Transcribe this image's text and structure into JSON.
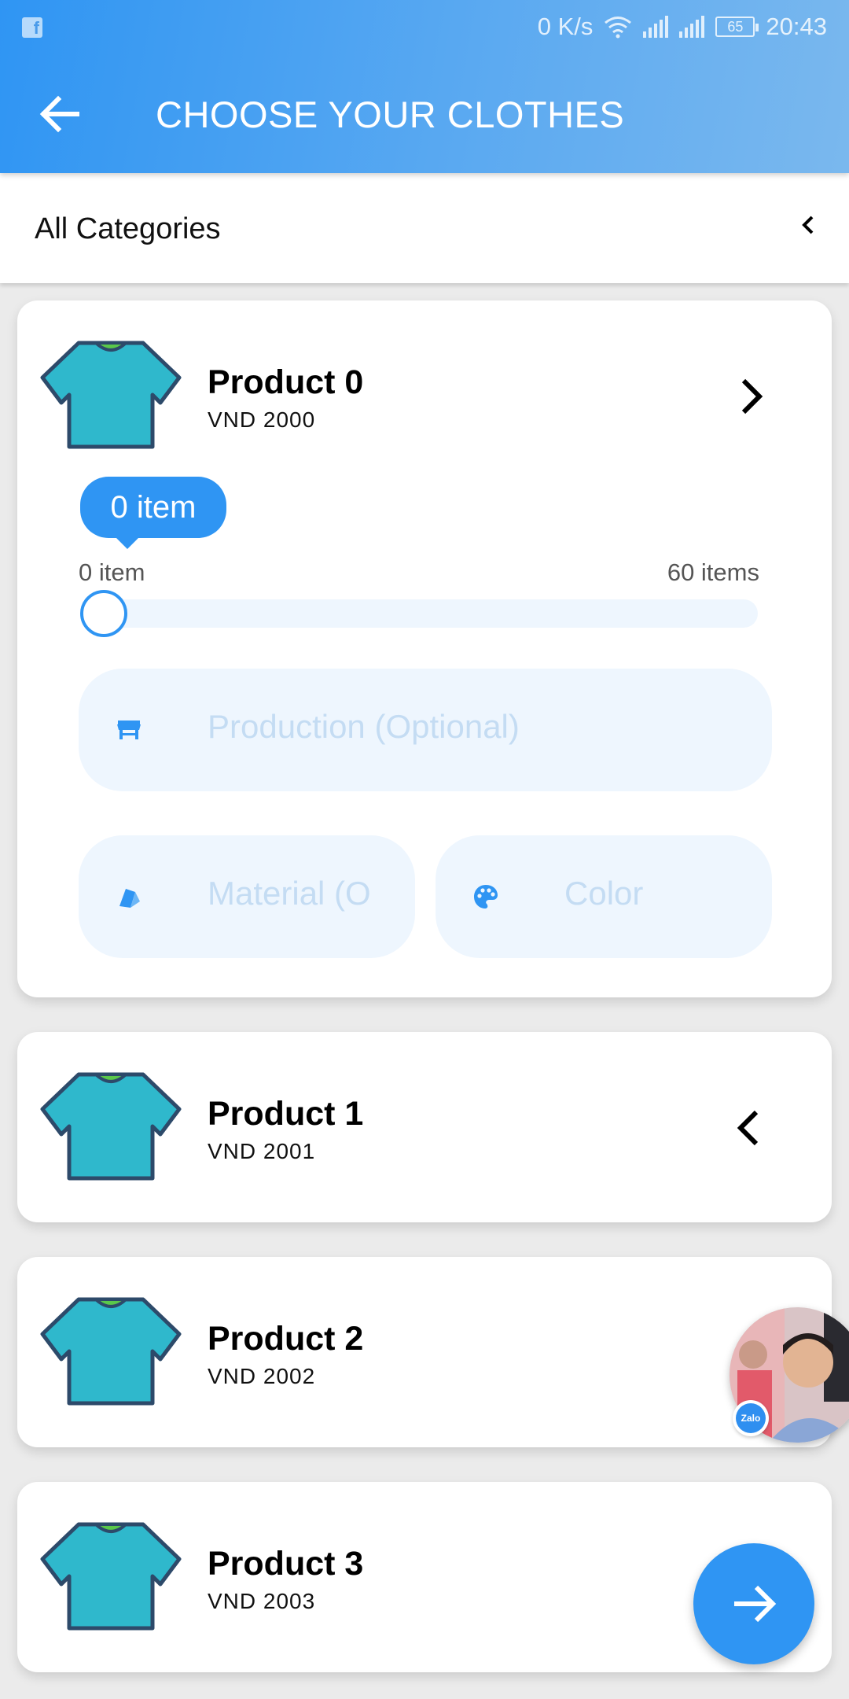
{
  "status_bar": {
    "network_speed": "0 K/s",
    "battery": "65",
    "time": "20:43",
    "icons": [
      "facebook-icon",
      "wifi-icon",
      "signal-icon",
      "battery-icon"
    ]
  },
  "app_bar": {
    "title": "CHOOSE YOUR CLOTHES",
    "back_icon": "arrow-left-icon"
  },
  "category": {
    "label": "All Categories",
    "toggle_icon": "chevron-left-icon"
  },
  "products": [
    {
      "name": "Product 0",
      "price": "VND 2000",
      "expanded": true,
      "chevron": "chevron-right-icon",
      "quantity": {
        "tooltip": "0 item",
        "min_label": "0 item",
        "max_label": "60 items",
        "value": 0,
        "max": 60
      },
      "fields": {
        "production_placeholder": "Production (Optional)",
        "material_placeholder": "Material (O",
        "color_placeholder": "Color"
      }
    },
    {
      "name": "Product 1",
      "price": "VND 2001",
      "expanded": false,
      "chevron": "chevron-left-icon"
    },
    {
      "name": "Product 2",
      "price": "VND 2002",
      "expanded": false
    },
    {
      "name": "Product 3",
      "price": "VND 2003",
      "expanded": false
    }
  ],
  "floating": {
    "chat_badge_label": "Zalo",
    "fab_icon": "arrow-right-icon"
  },
  "colors": {
    "primary": "#2f95f3",
    "field_bg": "#eef6fe",
    "placeholder": "#c4dcf3",
    "shirt": "#2fb8cc",
    "shirt_collar": "#5ac84a",
    "shirt_outline": "#2d4a6a"
  }
}
